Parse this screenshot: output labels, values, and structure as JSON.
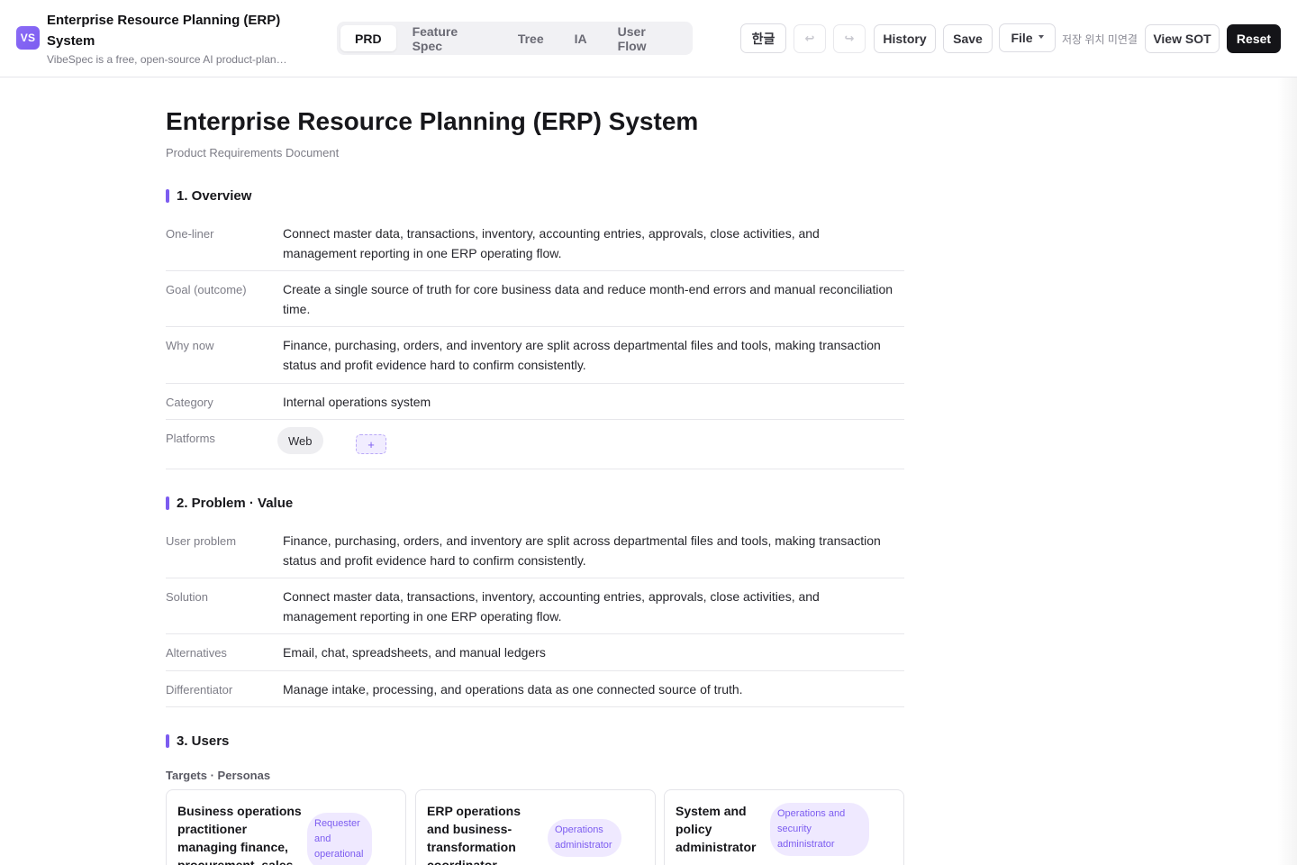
{
  "app": {
    "logo": "VS",
    "title": "Enterprise Resource Planning (ERP) System",
    "subtitle": "VibeSpec is a free, open-source AI product-plan…",
    "accent_color": "#7c5cf0"
  },
  "tabs": [
    {
      "label": "PRD",
      "active": true
    },
    {
      "label": "Feature Spec",
      "active": false
    },
    {
      "label": "Tree",
      "active": false
    },
    {
      "label": "IA",
      "active": false
    },
    {
      "label": "User Flow",
      "active": false
    }
  ],
  "toolbar": {
    "language_label": "한글",
    "undo_icon": "↩",
    "redo_icon": "↪",
    "history_label": "History",
    "save_label": "Save",
    "file_label": "File",
    "storage_status": "저장 위치 미연결",
    "view_sot_label": "View SOT",
    "reset_label": "Reset"
  },
  "document": {
    "title": "Enterprise Resource Planning (ERP) System",
    "type": "Product Requirements Document"
  },
  "overview": {
    "heading": "1. Overview",
    "one_liner_label": "One-liner",
    "one_liner": "Connect master data, transactions, inventory, accounting entries, approvals, close activities, and management reporting in one ERP operating flow.",
    "goal_label": "Goal (outcome)",
    "goal": "Create a single source of truth for core business data and reduce month-end errors and manual reconciliation time.",
    "why_now_label": "Why now",
    "why_now": "Finance, purchasing, orders, and inventory are split across departmental files and tools, making transaction status and profit evidence hard to confirm consistently.",
    "category_label": "Category",
    "category": "Internal operations system",
    "platforms_label": "Platforms",
    "platforms": [
      "Web"
    ],
    "add_platform": "+"
  },
  "problem": {
    "heading": "2. Problem · Value",
    "user_problem_label": "User problem",
    "user_problem": "Finance, purchasing, orders, and inventory are split across departmental files and tools, making transaction status and profit evidence hard to confirm consistently.",
    "solution_label": "Solution",
    "solution": "Connect master data, transactions, inventory, accounting entries, approvals, close activities, and management reporting in one ERP operating flow.",
    "alternatives_label": "Alternatives",
    "alternatives": "Email, chat, spreadsheets, and manual ledgers",
    "differentiator_label": "Differentiator",
    "differentiator": "Manage intake, processing, and operations data as one connected source of truth."
  },
  "users": {
    "heading": "3. Users",
    "subheading": "Targets · Personas",
    "personas": [
      {
        "title": "Business operations practitioner managing finance, procurement, sales, and inventory",
        "role": "Requester and operational"
      },
      {
        "title": "ERP operations and business-transformation coordinator",
        "role": "Operations administrator"
      },
      {
        "title": "System and policy administrator",
        "role": "Operations and security administrator"
      }
    ]
  }
}
